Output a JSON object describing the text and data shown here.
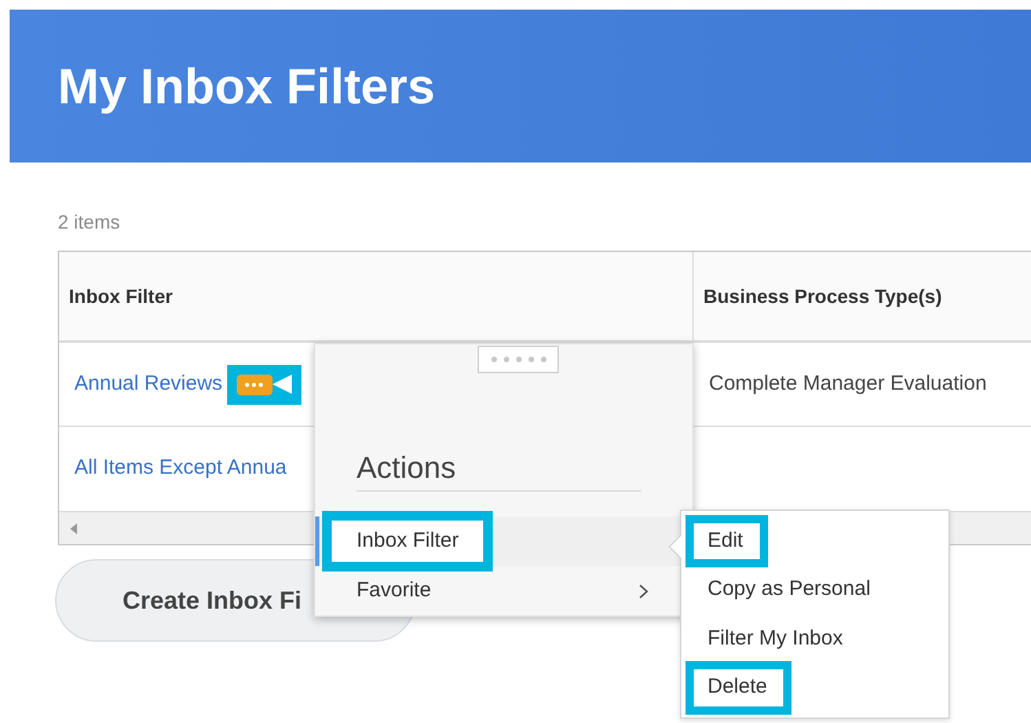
{
  "header": {
    "title": "My Inbox Filters"
  },
  "item_count": "2 items",
  "table": {
    "columns": [
      "Inbox Filter",
      "Business Process Type(s)"
    ],
    "rows": [
      {
        "cells": [
          "Annual Reviews",
          "Complete Manager Evaluation"
        ],
        "actions_button": {
          "highlighted": true
        }
      },
      {
        "cells": [
          "All Items Except Annua"
        ]
      }
    ]
  },
  "create_button": {
    "label": "Create Inbox Fi"
  },
  "actions_menu": {
    "title": "Actions",
    "items": [
      {
        "label": "Inbox Filter",
        "selected": true,
        "highlighted": true,
        "submenu_arrow": false
      },
      {
        "label": "Favorite",
        "selected": false,
        "highlighted": false,
        "submenu_arrow": true
      }
    ]
  },
  "submenu": {
    "items": [
      {
        "label": "Edit",
        "highlighted": true
      },
      {
        "label": "Copy as Personal",
        "highlighted": false
      },
      {
        "label": "Filter My Inbox",
        "highlighted": false
      },
      {
        "label": "Delete",
        "highlighted": true
      }
    ]
  }
}
